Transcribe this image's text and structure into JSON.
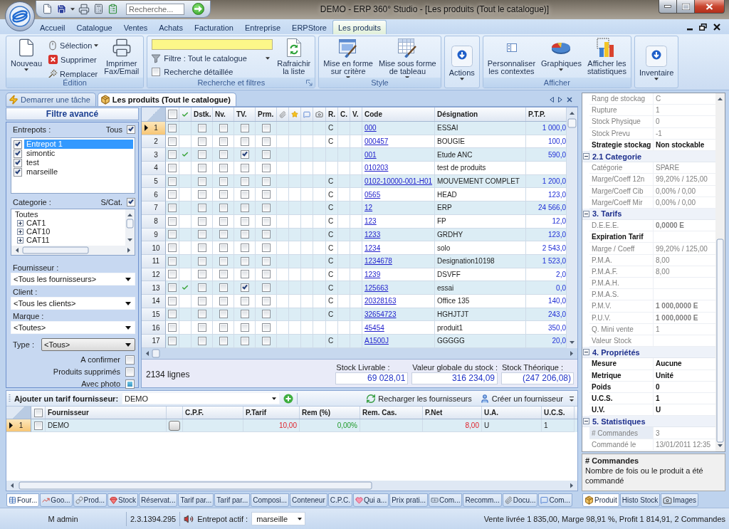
{
  "window": {
    "title": "DEMO - ERP 360° Studio - [Les produits (Tout le catalogue)]"
  },
  "quick_search": {
    "placeholder": "Recherche..."
  },
  "ribbon_tabs": [
    {
      "label": "Accueil",
      "selected": false
    },
    {
      "label": "Catalogue",
      "selected": false
    },
    {
      "label": "Ventes",
      "selected": false
    },
    {
      "label": "Achats",
      "selected": false
    },
    {
      "label": "Facturation",
      "selected": false
    },
    {
      "label": "Entreprise",
      "selected": false
    },
    {
      "label": "ERPStore",
      "selected": false
    },
    {
      "label": "Les produits",
      "selected": true
    }
  ],
  "ribbon_groups": [
    {
      "label": "Édition",
      "items": [
        {
          "kind": "large",
          "label": "Nouveau",
          "dropdown": true
        },
        {
          "kind": "small",
          "label": "Sélection",
          "dropdown": true
        },
        {
          "kind": "small",
          "label": "Supprimer",
          "dropdown": false
        },
        {
          "kind": "small",
          "label": "Remplacer",
          "dropdown": false
        },
        {
          "kind": "large",
          "label": "Imprimer\nFax/Email",
          "dropdown": false
        }
      ]
    },
    {
      "label": "Recherche et filtres",
      "dialog_launcher": true,
      "items": [
        {
          "kind": "search_field"
        },
        {
          "kind": "combo",
          "label": "Filtre : Tout le catalogue"
        },
        {
          "kind": "checkbox",
          "label": "Recherche détaillée",
          "checked": false
        },
        {
          "kind": "large",
          "label": "Rafraichir\nla liste",
          "dropdown": false
        }
      ]
    },
    {
      "label": "Style",
      "items": [
        {
          "kind": "large",
          "label": "Mise en forme\nsur critère",
          "dropdown": true
        },
        {
          "kind": "large",
          "label": "Mise sous forme\nde tableau",
          "dropdown": true
        }
      ]
    },
    {
      "items": [
        {
          "kind": "tile",
          "label": "Actions",
          "dropdown": true
        }
      ]
    },
    {
      "label": "Afficher",
      "items": [
        {
          "kind": "large",
          "label": "Personnaliser\nles contextes",
          "dropdown": false
        },
        {
          "kind": "large",
          "label": "Graphiques",
          "dropdown": true
        },
        {
          "kind": "large",
          "label": "Afficher les\nstatistiques",
          "dropdown": false
        }
      ]
    },
    {
      "items": [
        {
          "kind": "tile",
          "label": "Inventaire",
          "dropdown": true
        }
      ]
    }
  ],
  "document_tabs": [
    {
      "label": "Demarrer une tâche",
      "selected": false
    },
    {
      "label": "Les produits (Tout le catalogue)",
      "selected": true
    }
  ],
  "filter_panel": {
    "title": "Filtre avancé",
    "warehouses": {
      "label": "Entrepots :",
      "all_label": "Tous",
      "all_checked": true,
      "items": [
        {
          "label": "Entrepot 1",
          "checked": true,
          "selected": true
        },
        {
          "label": "simontic",
          "checked": true,
          "selected": false
        },
        {
          "label": "test",
          "checked": true,
          "selected": false
        },
        {
          "label": "marseille",
          "checked": true,
          "selected": false
        }
      ]
    },
    "categories": {
      "label": "Categorie :",
      "subcat_label": "S/Cat.",
      "subcat_checked": true,
      "tree": [
        {
          "label": "Toutes",
          "selected": false,
          "children": [
            {
              "label": "CAT1",
              "expanded": false,
              "selected": false
            },
            {
              "label": "CAT10",
              "expanded": false,
              "selected": false
            },
            {
              "label": "CAT11",
              "expanded": false,
              "selected": false
            }
          ]
        }
      ]
    },
    "fields": [
      {
        "label": "Fournisseur :",
        "value": "<Tous les fournisseurs>"
      },
      {
        "label": "Client :",
        "value": "<Tous les clients>"
      },
      {
        "label": "Marque :",
        "value": "<Toutes>"
      }
    ],
    "type": {
      "label": "Type :",
      "value": "<Tous>"
    },
    "options": [
      {
        "label": "A confirmer",
        "checked": false,
        "indeterminate": false
      },
      {
        "label": "Produits supprimés",
        "checked": false,
        "indeterminate": false
      },
      {
        "label": "Avec photo",
        "checked": false,
        "indeterminate": true
      }
    ]
  },
  "products_table": {
    "header_checked": false,
    "flag_columns": [
      "Dstk.",
      "Nv.",
      "TV.",
      "Prm."
    ],
    "letter_columns": [
      "R.",
      "C.",
      "V."
    ],
    "columns": [
      "Code",
      "Désignation",
      "P.T.P."
    ],
    "rows": [
      {
        "number": "1",
        "selected": true,
        "checked": false,
        "validated": false,
        "dstk": false,
        "nv": false,
        "tv": false,
        "prm": false,
        "r": "C",
        "code": "000",
        "designation": "ESSAI",
        "ptp": "1 000,0"
      },
      {
        "number": "2",
        "selected": false,
        "checked": false,
        "validated": false,
        "dstk": false,
        "nv": false,
        "tv": false,
        "prm": false,
        "r": "C",
        "code": "000457",
        "designation": "BOUGIE",
        "ptp": "100,0"
      },
      {
        "number": "3",
        "selected": false,
        "checked": false,
        "validated": true,
        "dstk": false,
        "nv": false,
        "tv": true,
        "prm": false,
        "code": "001",
        "designation": "Etude ANC",
        "ptp": "590,0"
      },
      {
        "number": "4",
        "selected": false,
        "checked": false,
        "validated": false,
        "dstk": false,
        "nv": false,
        "tv": false,
        "prm": false,
        "code": "010203",
        "designation": "test de produits"
      },
      {
        "number": "5",
        "selected": false,
        "checked": false,
        "validated": false,
        "dstk": false,
        "nv": false,
        "tv": false,
        "prm": false,
        "r": "C",
        "code": "0102-10000-001-H01",
        "designation": "MOUVEMENT COMPLET",
        "ptp": "1 200,0"
      },
      {
        "number": "6",
        "selected": false,
        "checked": false,
        "validated": false,
        "dstk": false,
        "nv": false,
        "tv": false,
        "prm": false,
        "r": "C",
        "code": "0565",
        "designation": "HEAD",
        "ptp": "123,0"
      },
      {
        "number": "7",
        "selected": false,
        "checked": false,
        "validated": false,
        "dstk": false,
        "nv": false,
        "tv": false,
        "prm": false,
        "r": "C",
        "code": "12",
        "designation": "ERP",
        "ptp": "24 566,0"
      },
      {
        "number": "8",
        "selected": false,
        "checked": false,
        "validated": false,
        "dstk": false,
        "nv": false,
        "tv": false,
        "prm": false,
        "r": "C",
        "code": "123",
        "designation": "FP",
        "ptp": "12,0"
      },
      {
        "number": "9",
        "selected": false,
        "checked": false,
        "validated": false,
        "dstk": false,
        "nv": false,
        "tv": false,
        "prm": false,
        "r": "C",
        "code": "1233",
        "designation": "GRDHY",
        "ptp": "123,0"
      },
      {
        "number": "10",
        "selected": false,
        "checked": false,
        "validated": false,
        "dstk": false,
        "nv": false,
        "tv": false,
        "prm": false,
        "r": "C",
        "code": "1234",
        "designation": "solo",
        "ptp": "2 543,0"
      },
      {
        "number": "11",
        "selected": false,
        "checked": false,
        "validated": false,
        "dstk": false,
        "nv": false,
        "tv": false,
        "prm": false,
        "r": "C",
        "code": "1234678",
        "designation": "Designation10198",
        "ptp": "1 523,0"
      },
      {
        "number": "12",
        "selected": false,
        "checked": false,
        "validated": false,
        "dstk": false,
        "nv": false,
        "tv": false,
        "prm": false,
        "r": "C",
        "code": "1239",
        "designation": "DSVFF",
        "ptp": "2,0"
      },
      {
        "number": "13",
        "selected": false,
        "checked": false,
        "validated": true,
        "dstk": false,
        "nv": false,
        "tv": true,
        "prm": false,
        "r": "C",
        "code": "125663",
        "designation": "essai",
        "ptp": "0,0"
      },
      {
        "number": "14",
        "selected": false,
        "checked": false,
        "validated": false,
        "dstk": false,
        "nv": false,
        "tv": false,
        "prm": false,
        "r": "C",
        "code": "20328163",
        "designation": "Office 135",
        "ptp": "140,0"
      },
      {
        "number": "15",
        "selected": false,
        "checked": false,
        "validated": false,
        "dstk": false,
        "nv": false,
        "tv": false,
        "prm": false,
        "r": "C",
        "code": "32654723",
        "designation": "HGHJTJT",
        "ptp": "243,0"
      },
      {
        "number": "16",
        "selected": false,
        "checked": false,
        "validated": false,
        "dstk": false,
        "nv": false,
        "tv": false,
        "prm": false,
        "code": "45454",
        "designation": "produit1",
        "ptp": "350,0"
      },
      {
        "number": "17",
        "selected": false,
        "checked": false,
        "validated": false,
        "dstk": false,
        "nv": false,
        "tv": false,
        "prm": false,
        "r": "C",
        "code": "A1500J",
        "designation": "GGGGG",
        "ptp": "20,0"
      }
    ]
  },
  "table_footer": {
    "count": "2134 lignes",
    "totals": [
      {
        "label": "Stock Livrable :",
        "value": "69 028,01"
      },
      {
        "label": "Valeur globale du stock :",
        "value": "316 234,09"
      },
      {
        "label": "Stock Théorique :",
        "value": "(247 206,08)"
      }
    ]
  },
  "supplier_panel": {
    "add_label": "Ajouter un tarif fournisseur:",
    "add_value": "DEMO",
    "actions": [
      "Recharger les fournisseurs",
      "Créer un fournisseur"
    ],
    "header_checked": false,
    "columns": [
      "Fournisseur",
      "C.P.F.",
      "P.Tarif",
      "Rem (%)",
      "Rem. Cas.",
      "P.Net",
      "U.A.",
      "U.C.S."
    ],
    "rows": [
      {
        "number": "1",
        "selected": true,
        "checked": false,
        "supplier": "DEMO",
        "p_tarif": "10,00",
        "rem": "0,00%",
        "p_net": "8,00",
        "ua": "U",
        "ucs": "1"
      }
    ]
  },
  "detail_tabs": [
    {
      "label": "Four...",
      "selected": true
    },
    {
      "label": "Goo...",
      "selected": false
    },
    {
      "label": "Prod...",
      "selected": false
    },
    {
      "label": "Stock",
      "selected": false
    },
    {
      "label": "Réservat...",
      "selected": false
    },
    {
      "label": "Tarif par...",
      "selected": false
    },
    {
      "label": "Tarif par...",
      "selected": false
    },
    {
      "label": "Composi...",
      "selected": false
    },
    {
      "label": "Conteneur",
      "selected": false
    },
    {
      "label": "C.P.C.",
      "selected": false
    },
    {
      "label": "Qui a...",
      "selected": false
    },
    {
      "label": "Prix prati...",
      "selected": false
    },
    {
      "label": "Com...",
      "selected": false
    },
    {
      "label": "Recomm...",
      "selected": false
    },
    {
      "label": "Docu...",
      "selected": false
    },
    {
      "label": "Com...",
      "selected": false
    }
  ],
  "properties": {
    "items": [
      {
        "label": "Rang de stockag",
        "value": "C",
        "readonly": true,
        "emphasis": false,
        "selected": false
      },
      {
        "label": "Rupture",
        "value": "1",
        "readonly": true,
        "emphasis": false,
        "selected": false
      },
      {
        "label": "Stock Physique",
        "value": "0",
        "readonly": true,
        "emphasis": false,
        "selected": false
      },
      {
        "label": "Stock Prevu",
        "value": "-1",
        "readonly": true,
        "emphasis": false,
        "selected": false
      },
      {
        "label": "Strategie stockag",
        "value": "Non stockable",
        "readonly": false,
        "emphasis": true,
        "selected": false
      }
    ],
    "categories": [
      {
        "label": "2.1 Categorie",
        "expanded": true,
        "children": [
          {
            "label": "Catégorie",
            "value": "SPARE",
            "readonly": true,
            "emphasis": false,
            "selected": false
          },
          {
            "label": "Marge/Coeff 12n",
            "value": "99,20% / 125,00",
            "readonly": true,
            "emphasis": false,
            "selected": false
          },
          {
            "label": "Marge/Coeff Cib",
            "value": "0,00% / 0,00",
            "readonly": true,
            "emphasis": false,
            "selected": false
          },
          {
            "label": "Marge/Coeff Mir",
            "value": "0,00% / 0,00",
            "readonly": true,
            "emphasis": false,
            "selected": false
          }
        ]
      },
      {
        "label": "3. Tarifs",
        "expanded": true,
        "children": [
          {
            "label": "D.E.E.E.",
            "value": "0,0000 E",
            "readonly": true,
            "emphasis": true,
            "selected": false
          },
          {
            "label": "Expiration Tarif",
            "readonly": false,
            "selected": false
          },
          {
            "label": "Marge / Coeff",
            "value": "99,20% / 125,00",
            "readonly": true,
            "emphasis": false,
            "selected": false
          },
          {
            "label": "P.M.A.",
            "value": "8,00",
            "readonly": true,
            "emphasis": false,
            "selected": false
          },
          {
            "label": "P.M.A.F.",
            "value": "8,00",
            "readonly": true,
            "emphasis": false,
            "selected": false
          },
          {
            "label": "P.M.A.H.",
            "readonly": true,
            "selected": false
          },
          {
            "label": "P.M.A.S.",
            "readonly": true,
            "selected": false
          },
          {
            "label": "P.M.V.",
            "value": "1 000,0000 E",
            "readonly": true,
            "emphasis": true,
            "selected": false
          },
          {
            "label": "P.U.V.",
            "value": "1 000,0000 E",
            "readonly": true,
            "emphasis": true,
            "selected": false
          },
          {
            "label": "Q. Mini vente",
            "value": "1",
            "readonly": true,
            "emphasis": false,
            "selected": false
          },
          {
            "label": "Valeur Stock",
            "readonly": true,
            "selected": false
          }
        ]
      },
      {
        "label": "4. Propriétés",
        "expanded": true,
        "children": [
          {
            "label": "Mesure",
            "value": "Aucune",
            "readonly": false,
            "emphasis": true,
            "selected": false
          },
          {
            "label": "Metrique",
            "value": "Unité",
            "readonly": false,
            "emphasis": true,
            "selected": false
          },
          {
            "label": "Poids",
            "value": "0",
            "readonly": false,
            "emphasis": true,
            "selected": false
          },
          {
            "label": "U.C.S.",
            "value": "1",
            "readonly": false,
            "emphasis": true,
            "selected": false
          },
          {
            "label": "U.V.",
            "value": "U",
            "readonly": false,
            "emphasis": true,
            "selected": false
          }
        ]
      },
      {
        "label": "5. Statistiques",
        "expanded": true,
        "children": [
          {
            "label": "# Commandes",
            "value": "3",
            "readonly": true,
            "emphasis": false,
            "selected": true
          },
          {
            "label": "Commandé le",
            "value": "13/01/2011 12:35",
            "readonly": true,
            "emphasis": false,
            "selected": false
          }
        ]
      }
    ]
  },
  "property_description": {
    "title": "# Commandes",
    "text": "Nombre de fois ou le produit a été commandé"
  },
  "side_tabs": [
    {
      "label": "Produit",
      "selected": true
    },
    {
      "label": "Histo Stock",
      "selected": false
    },
    {
      "label": "Images",
      "selected": false
    }
  ],
  "status_bar": {
    "user": "M admin",
    "version": "2.3.1394.295",
    "warehouse_label": "Entrepot actif :",
    "warehouse": "marseille",
    "summary": "Vente livrée 1 835,00, Marge 98,91 %, Profit 1 814,91, 2 Commandes"
  }
}
